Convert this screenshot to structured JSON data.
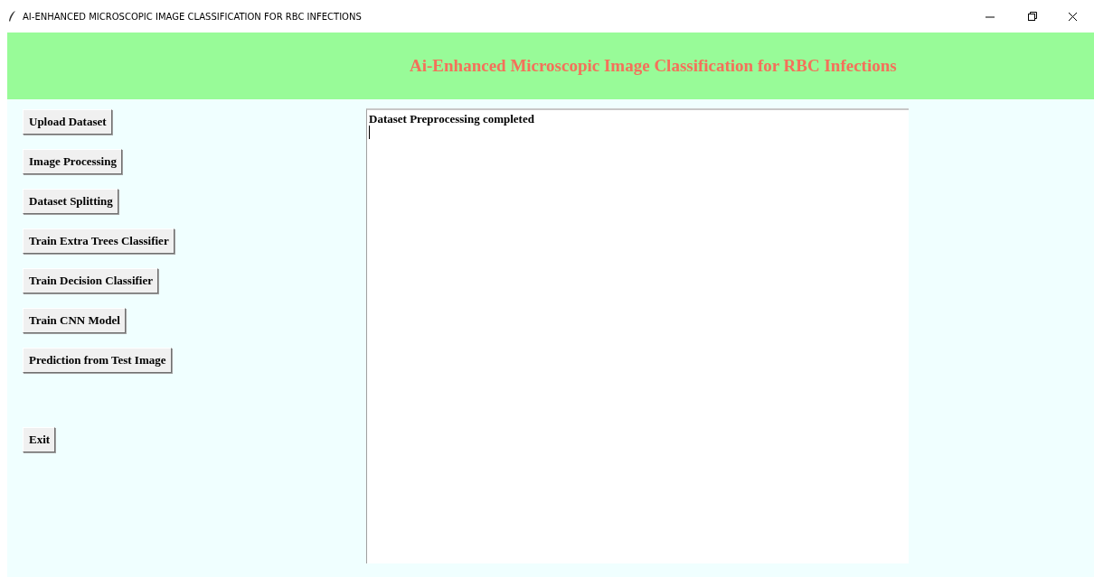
{
  "window": {
    "title": "AI-ENHANCED MICROSCOPIC IMAGE CLASSIFICATION FOR RBC INFECTIONS"
  },
  "header": {
    "title": "Ai-Enhanced Microscopic Image Classification for RBC Infections"
  },
  "buttons": [
    {
      "label": "Upload Dataset",
      "kind": "action"
    },
    {
      "label": "Image Processing",
      "kind": "action"
    },
    {
      "label": "Dataset Splitting",
      "kind": "action"
    },
    {
      "label": "Train Extra Trees Classifier",
      "kind": "action"
    },
    {
      "label": "Train Decision Classifier",
      "kind": "action"
    },
    {
      "label": "Train CNN Model",
      "kind": "action"
    },
    {
      "label": "Prediction from Test Image",
      "kind": "action"
    },
    {
      "label": "Exit",
      "kind": "exit"
    }
  ],
  "output": {
    "text": "Dataset Preprocessing completed"
  }
}
